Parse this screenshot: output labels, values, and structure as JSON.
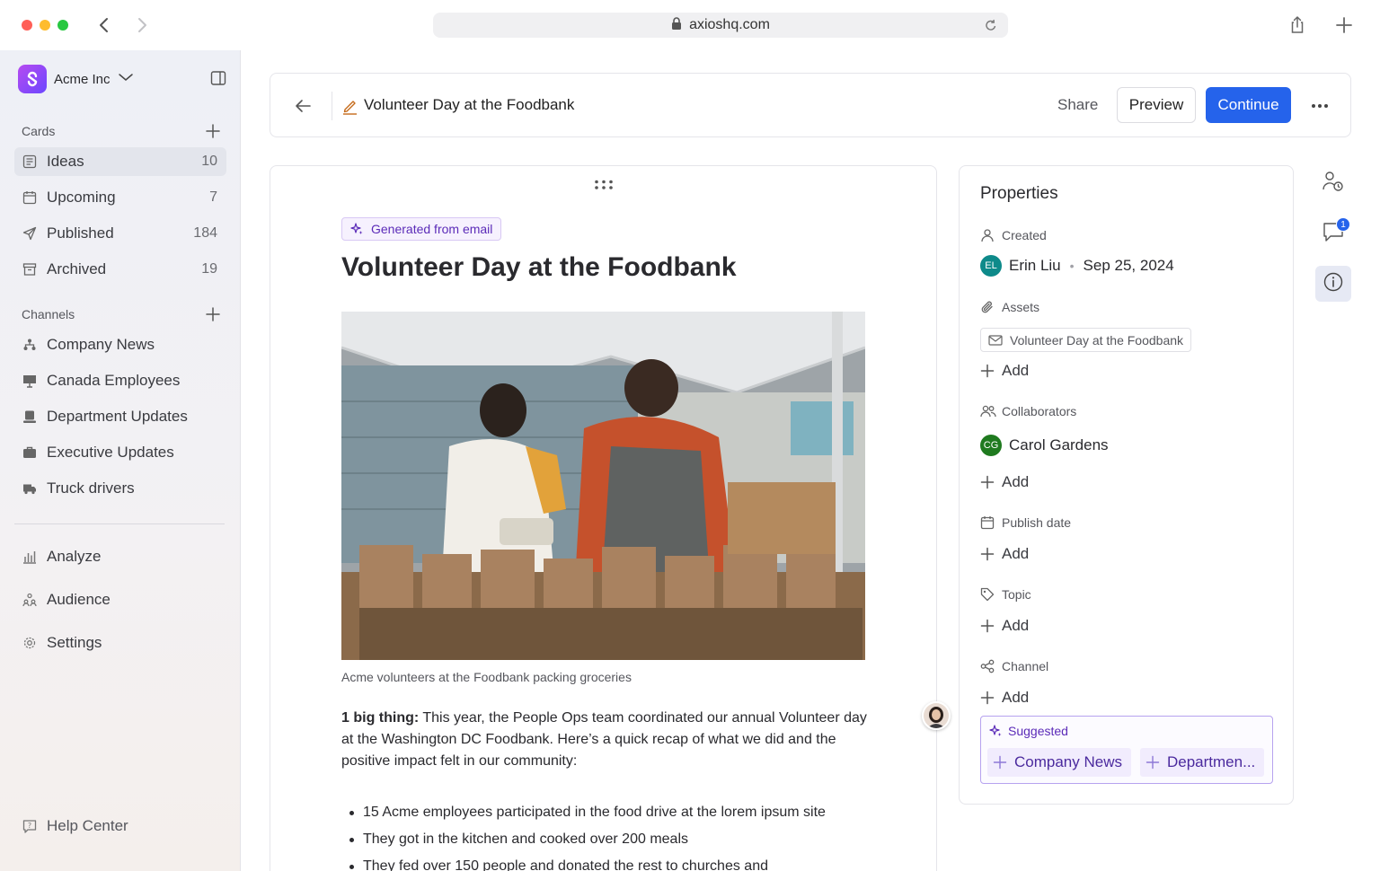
{
  "browser": {
    "url": "axioshq.com"
  },
  "workspace": {
    "name": "Acme Inc"
  },
  "sidebar": {
    "cards_heading": "Cards",
    "cards": [
      {
        "label": "Ideas",
        "count": "10",
        "icon": "ideas-icon"
      },
      {
        "label": "Upcoming",
        "count": "7",
        "icon": "calendar-icon"
      },
      {
        "label": "Published",
        "count": "184",
        "icon": "paper-plane-icon"
      },
      {
        "label": "Archived",
        "count": "19",
        "icon": "archive-icon"
      }
    ],
    "channels_heading": "Channels",
    "channels": [
      {
        "label": "Company News",
        "icon": "org-chart-icon"
      },
      {
        "label": "Canada Employees",
        "icon": "presentation-icon"
      },
      {
        "label": "Department Updates",
        "icon": "laptop-icon"
      },
      {
        "label": "Executive Updates",
        "icon": "briefcase-icon"
      },
      {
        "label": "Truck drivers",
        "icon": "truck-icon"
      }
    ],
    "tools": [
      {
        "label": "Analyze",
        "icon": "bar-chart-icon"
      },
      {
        "label": "Audience",
        "icon": "people-icon"
      },
      {
        "label": "Settings",
        "icon": "gear-icon"
      }
    ],
    "help": "Help Center"
  },
  "toolbar": {
    "title": "Volunteer Day at the Foodbank",
    "share_label": "Share",
    "preview_label": "Preview",
    "continue_label": "Continue"
  },
  "editor": {
    "badge": "Generated from email",
    "title": "Volunteer Day at the Foodbank",
    "caption": "Acme volunteers at the Foodbank packing groceries",
    "lead_bold": "1 big thing:",
    "lead_text": " This year, the People Ops team coordinated our annual Volunteer day at the Washington DC Foodbank. Here’s a quick recap of what we did and the positive impact felt in our community:",
    "bullets": [
      "15 Acme employees participated in the food drive at the lorem ipsum site",
      "They got in the kitchen and cooked over 200 meals",
      "They fed over 150 people and donated the rest to churches and"
    ]
  },
  "properties": {
    "title": "Properties",
    "created_label": "Created",
    "created_by_initials": "EL",
    "created_by": "Erin Liu",
    "created_date": "Sep 25, 2024",
    "assets_label": "Assets",
    "asset_name": "Volunteer Day at the Foodbank",
    "collaborators_label": "Collaborators",
    "collaborator_initials": "CG",
    "collaborator_name": "Carol Gardens",
    "publish_date_label": "Publish date",
    "topic_label": "Topic",
    "channel_label": "Channel",
    "add_label": "Add",
    "suggested_label": "Suggested",
    "suggested_chips": [
      "Company News",
      "Departmen..."
    ]
  },
  "rail": {
    "comments_badge": "1"
  },
  "colors": {
    "accent": "#2563eb",
    "ai_purple": "#5b2bb8",
    "erin_avatar": "#0e8a8a",
    "carol_avatar": "#1f7a1f"
  }
}
